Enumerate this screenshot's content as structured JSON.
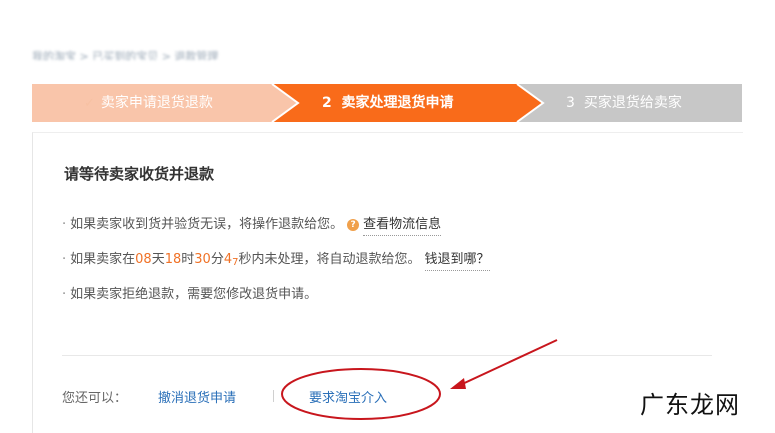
{
  "breadcrumb": {
    "text": "我的淘宝 > 已买到的宝贝 > 退款管理"
  },
  "steps": [
    {
      "number": "",
      "label": "卖家申请退货退款",
      "state": "done"
    },
    {
      "number": "2",
      "label": "卖家处理退货申请",
      "state": "active"
    },
    {
      "number": "3",
      "label": "买家退货给卖家",
      "state": "pending"
    }
  ],
  "colors": {
    "step_done": "#f9c5aa",
    "step_active": "#f96b1a",
    "step_pending": "#c7c7c7",
    "link": "#2a6fb8",
    "number_highlight": "#f07227",
    "annotation_red": "#c8161d"
  },
  "main": {
    "title": "请等待卖家收货并退款",
    "line1": {
      "text": "如果卖家收到货并验货无误，将操作退款给您。",
      "link": "查看物流信息",
      "icon": "question-icon"
    },
    "line2": {
      "prefix": "如果卖家在",
      "days": "08",
      "days_unit": "天",
      "hours": "18",
      "hours_unit": "时",
      "minutes": "30",
      "minutes_unit": "分",
      "seconds_a": "4",
      "seconds_b": "7",
      "seconds_unit": "秒",
      "suffix": "内未处理，将自动退款给您。",
      "link": "钱退到哪？"
    },
    "line3": {
      "text": "如果卖家拒绝退款，需要您修改退货申请。"
    }
  },
  "actions": {
    "label": "您还可以：",
    "cancel": "撤消退货申请",
    "intervene": "要求淘宝介入"
  },
  "watermark": "广东龙网"
}
